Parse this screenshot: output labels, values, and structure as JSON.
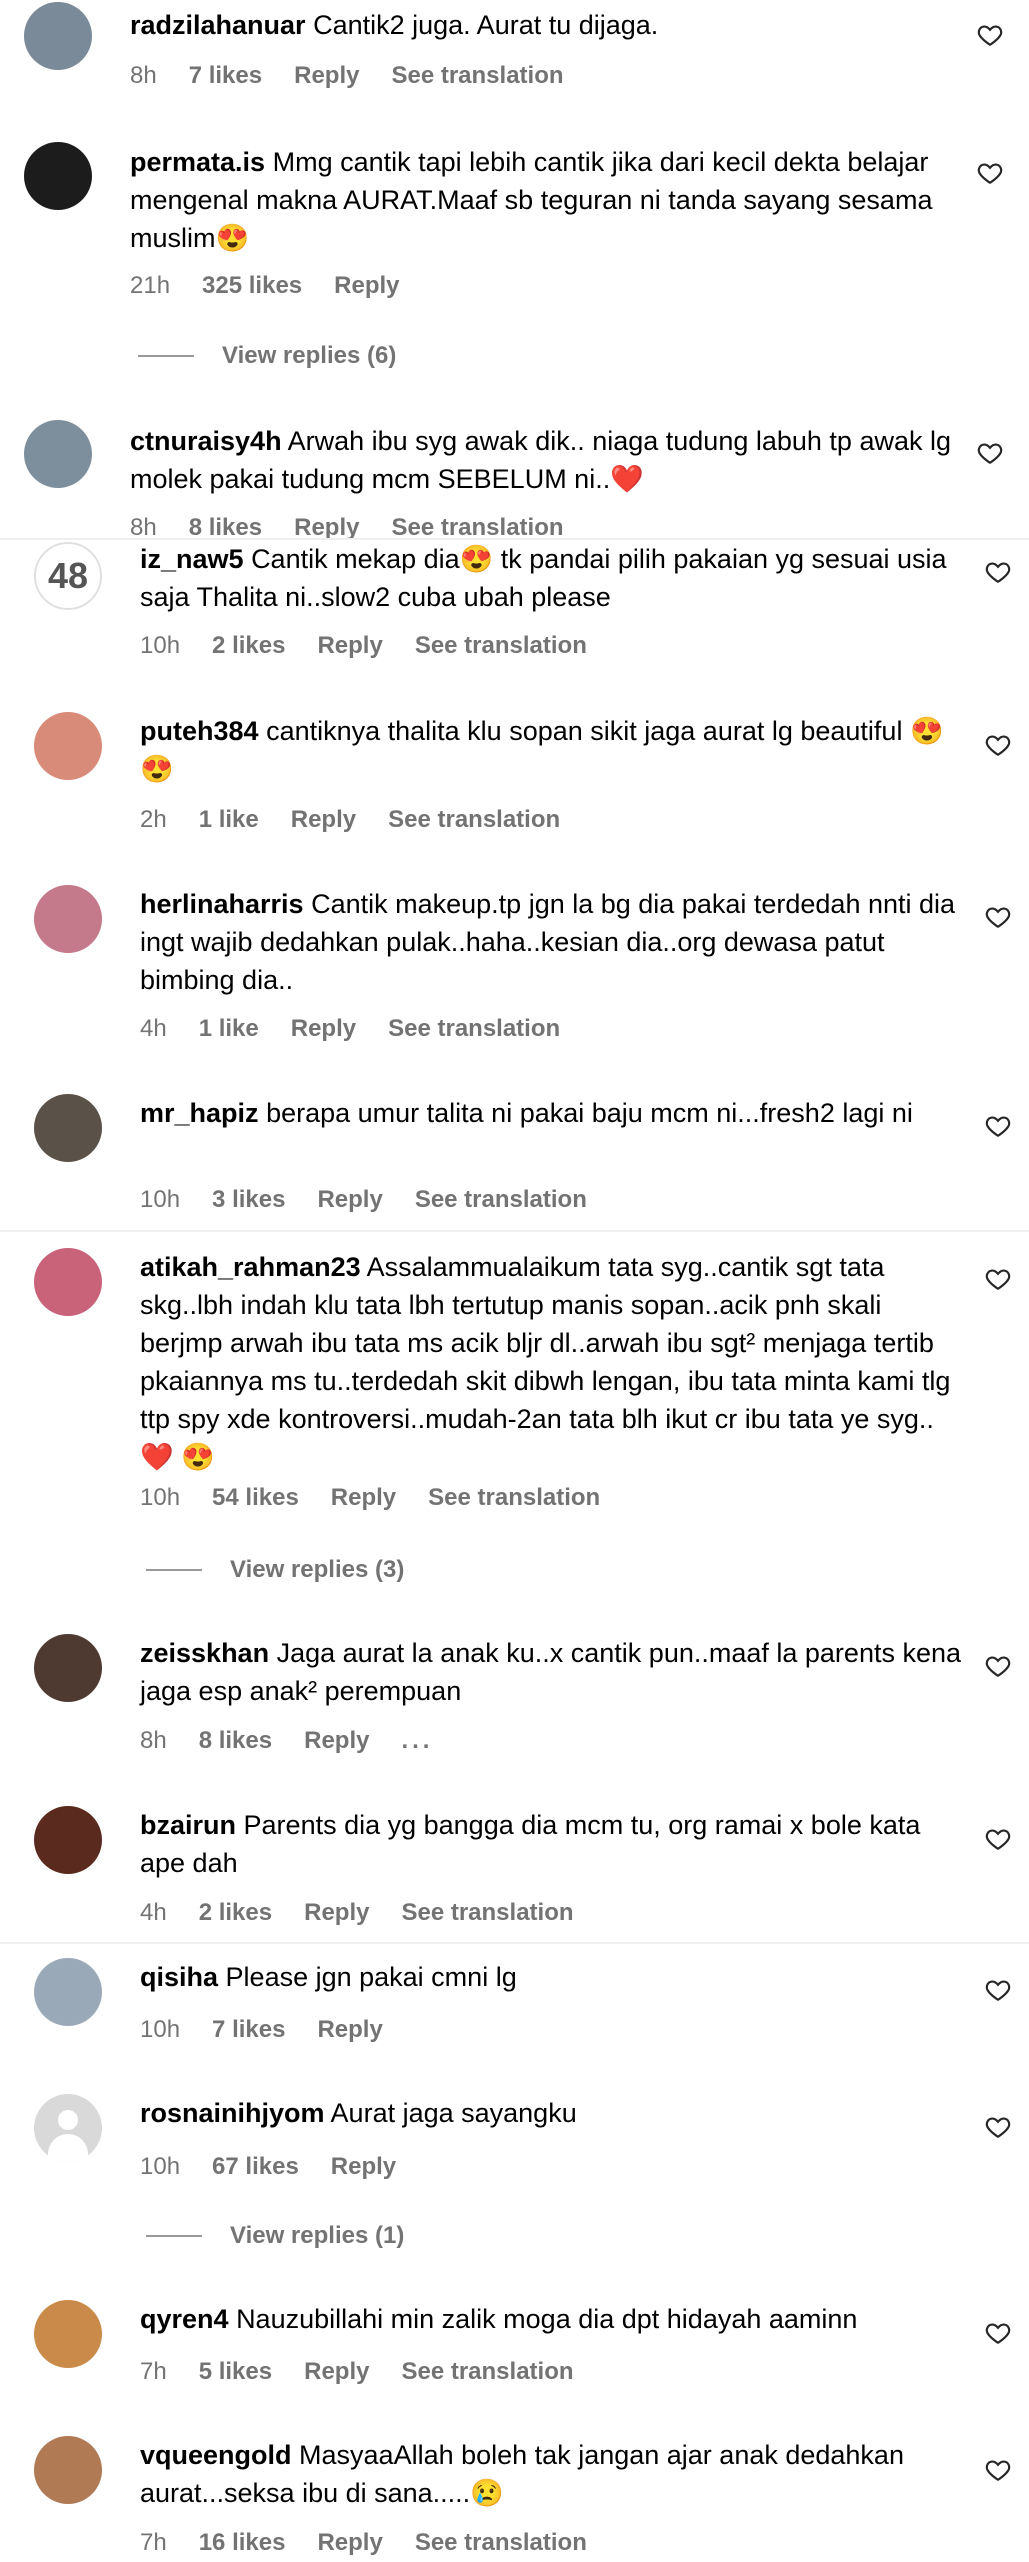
{
  "comments": [
    {
      "user": "radzilahanuar",
      "text": "Cantik2 juga. Aurat tu dijaga.",
      "time": "8h",
      "likes": "7 likes",
      "reply": "Reply",
      "translate": "See translation",
      "avatar": "photo",
      "avatar_color": "#7a8a98"
    },
    {
      "user": "permata.is",
      "text": "Mmg cantik tapi lebih cantik jika dari kecil dekta belajar mengenal makna AURAT.Maaf sb teguran ni tanda sayang sesama muslim😍",
      "time": "21h",
      "likes": "325 likes",
      "reply": "Reply",
      "translate": "",
      "avatar": "photo",
      "avatar_color": "#1c1c1c",
      "view_replies": "View replies (6)"
    },
    {
      "user": "ctnuraisy4h",
      "text": "Arwah ibu syg awak dik.. niaga tudung labuh tp awak lg molek pakai tudung mcm SEBELUM ni..❤️",
      "time": "8h",
      "likes": "8 likes",
      "reply": "Reply",
      "translate": "See translation",
      "avatar": "photo",
      "avatar_color": "#7d8f9c"
    },
    {
      "user": "iz_naw5",
      "text": "Cantik mekap dia😍 tk pandai pilih pakaian yg sesuai usia saja Thalita ni..slow2 cuba ubah please",
      "time": "10h",
      "likes": "2 likes",
      "reply": "Reply",
      "translate": "See translation",
      "avatar": "number",
      "avatar_text": "48"
    },
    {
      "user": "puteh384",
      "text": "cantiknya thalita klu sopan sikit jaga aurat lg beautiful 😍 😍",
      "time": "2h",
      "likes": "1 like",
      "reply": "Reply",
      "translate": "See translation",
      "avatar": "photo",
      "avatar_color": "#d98b7a"
    },
    {
      "user": "herlinaharris",
      "text": "Cantik makeup.tp jgn la bg dia pakai terdedah nnti dia ingt wajib dedahkan pulak..haha..kesian dia..org dewasa patut bimbing dia..",
      "time": "4h",
      "likes": "1 like",
      "reply": "Reply",
      "translate": "See translation",
      "avatar": "photo",
      "avatar_color": "#c47a8a"
    },
    {
      "user": "mr_hapiz",
      "text": "berapa umur talita ni pakai baju mcm ni...fresh2 lagi ni",
      "time": "10h",
      "likes": "3 likes",
      "reply": "Reply",
      "translate": "See translation",
      "avatar": "photo",
      "avatar_color": "#5a5248"
    },
    {
      "user": "atikah_rahman23",
      "text": "Assalammualaikum tata syg..cantik sgt tata skg..lbh indah klu tata lbh tertutup manis sopan..acik pnh skali berjmp arwah ibu tata ms acik bljr dl..arwah ibu sgt² menjaga tertib pkaiannya ms tu..terdedah skit dibwh lengan, ibu tata minta kami tlg ttp spy xde kontroversi..mudah-2an tata blh ikut cr ibu tata ye syg..❤️ 😍",
      "time": "10h",
      "likes": "54 likes",
      "reply": "Reply",
      "translate": "See translation",
      "avatar": "photo",
      "avatar_color": "#c9637a",
      "view_replies": "View replies (3)"
    },
    {
      "user": "zeisskhan",
      "text": "Jaga aurat la anak ku..x cantik pun..maaf la parents kena jaga esp anak² perempuan",
      "time": "8h",
      "likes": "8 likes",
      "reply": "Reply",
      "translate": "...",
      "avatar": "photo",
      "avatar_color": "#4e3a30"
    },
    {
      "user": "bzairun",
      "text": "Parents dia yg bangga dia mcm tu, org ramai x bole kata ape dah",
      "time": "4h",
      "likes": "2 likes",
      "reply": "Reply",
      "translate": "See translation",
      "avatar": "photo",
      "avatar_color": "#5a2a1e"
    },
    {
      "user": "qisiha",
      "text": "Please jgn pakai cmni lg",
      "time": "10h",
      "likes": "7 likes",
      "reply": "Reply",
      "translate": "",
      "avatar": "photo",
      "avatar_color": "#9aa9b7"
    },
    {
      "user": "rosnainihjyom",
      "text": "Aurat jaga sayangku",
      "time": "10h",
      "likes": "67 likes",
      "reply": "Reply",
      "translate": "",
      "avatar": "generic",
      "view_replies": "View replies (1)"
    },
    {
      "user": "qyren4",
      "text": "Nauzubillahi min zalik moga dia dpt hidayah aaminn",
      "time": "7h",
      "likes": "5 likes",
      "reply": "Reply",
      "translate": "See translation",
      "avatar": "photo",
      "avatar_color": "#c98a4a"
    },
    {
      "user": "vqueengold",
      "text": "MasyaaAllah boleh tak jangan ajar anak dedahkan aurat...seksa ibu di sana.....😢",
      "time": "7h",
      "likes": "16 likes",
      "reply": "Reply",
      "translate": "See translation",
      "avatar": "photo",
      "avatar_color": "#b07a55"
    }
  ]
}
